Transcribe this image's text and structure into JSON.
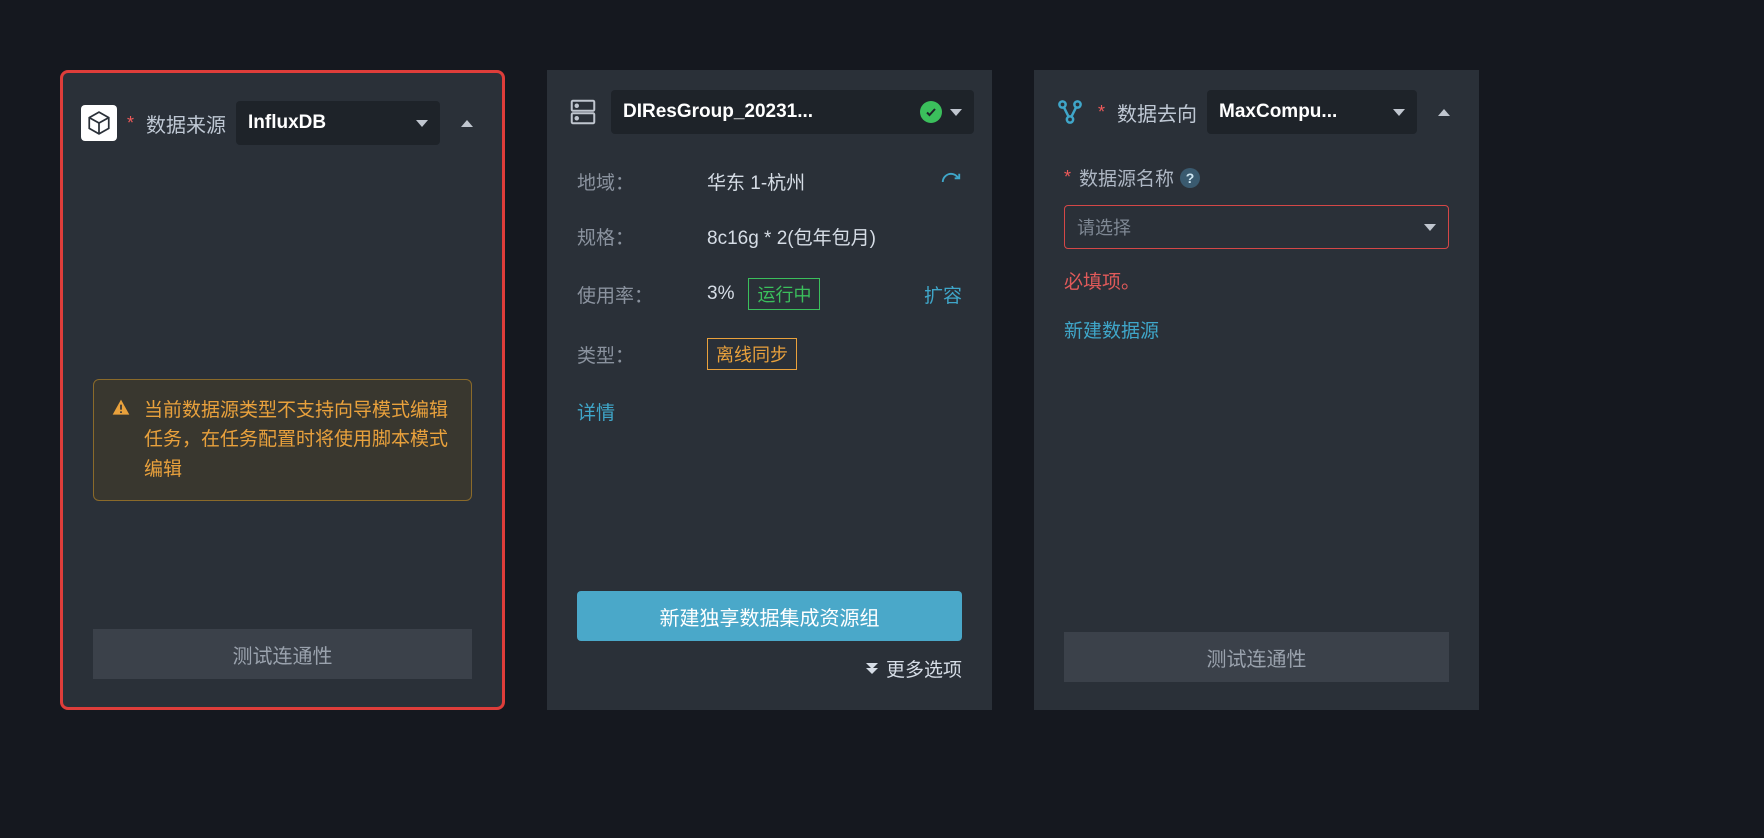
{
  "source_panel": {
    "title": "数据来源",
    "select_value": "InfluxDB",
    "warning": "当前数据源类型不支持向导模式编辑任务，在任务配置时将使用脚本模式编辑",
    "test_button": "测试连通性"
  },
  "resource_panel": {
    "select_value": "DIResGroup_20231...",
    "region_label": "地域：",
    "region_value": "华东 1-杭州",
    "spec_label": "规格：",
    "spec_value": "8c16g * 2(包年包月)",
    "usage_label": "使用率：",
    "usage_value": "3%",
    "running_tag": "运行中",
    "expand_link": "扩容",
    "type_label": "类型：",
    "type_tag": "离线同步",
    "details_link": "详情",
    "create_button": "新建独享数据集成资源组",
    "more_options": "更多选项"
  },
  "target_panel": {
    "title": "数据去向",
    "select_value": "MaxCompu...",
    "ds_name_label": "数据源名称",
    "ds_placeholder": "请选择",
    "required_error": "必填项。",
    "new_ds_link": "新建数据源",
    "test_button": "测试连通性"
  }
}
